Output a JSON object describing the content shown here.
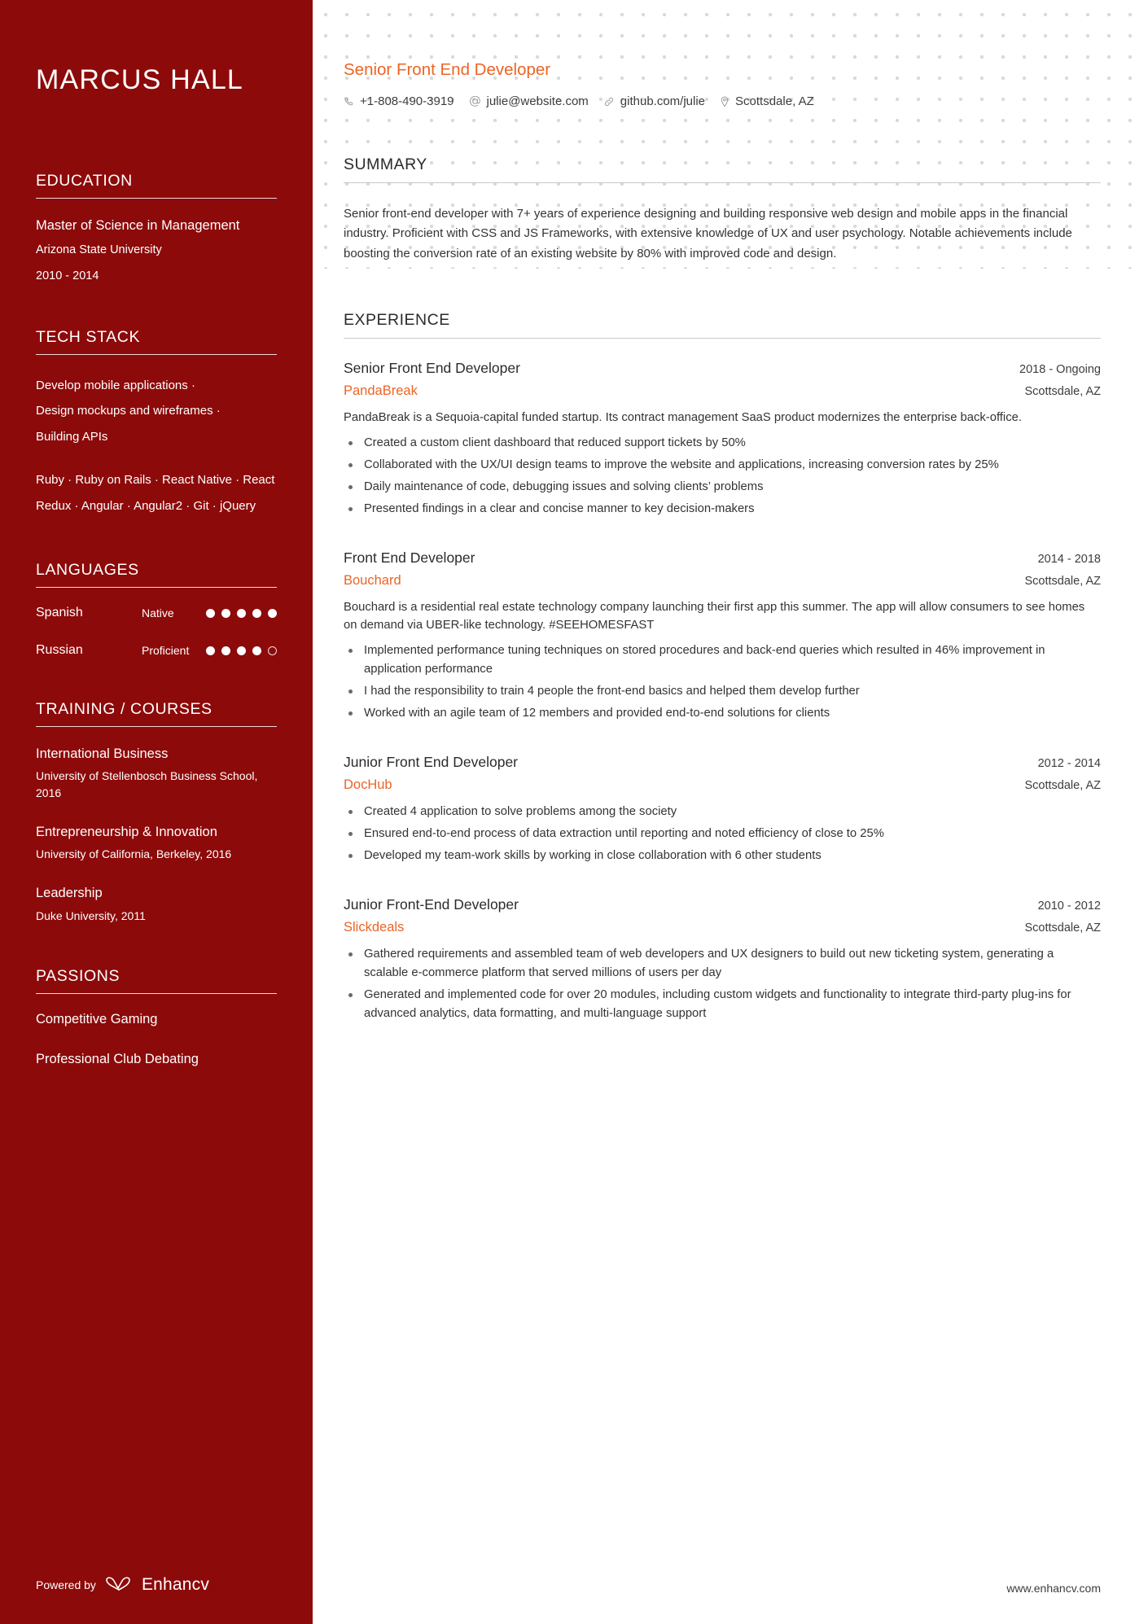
{
  "colors": {
    "sidebar_bg": "#8d0a0a",
    "accent_orange": "#ec6425",
    "text_dark": "#333333",
    "rule": "#c9c9c9"
  },
  "sidebar": {
    "name": "MARCUS HALL",
    "education": {
      "heading": "EDUCATION",
      "entries": [
        {
          "degree": "Master of Science in Management",
          "school": "Arizona State University",
          "dates": "2010 - 2014"
        }
      ]
    },
    "tech_stack": {
      "heading": "TECH STACK",
      "group_one": [
        "Develop mobile applications ·",
        "Design mockups and wireframes ·",
        "Building APIs"
      ],
      "group_two": "Ruby · Ruby on Rails · React Native · React Redux · Angular · Angular2 · Git · jQuery"
    },
    "languages": {
      "heading": "LANGUAGES",
      "items": [
        {
          "name": "Spanish",
          "level": "Native",
          "filled": 5,
          "total": 5
        },
        {
          "name": "Russian",
          "level": "Proficient",
          "filled": 4,
          "total": 5
        }
      ]
    },
    "training": {
      "heading": "TRAINING / COURSES",
      "items": [
        {
          "title": "International Business",
          "sub": "University of Stellenbosch Business School, 2016"
        },
        {
          "title": "Entrepreneurship & Innovation",
          "sub": "University of California, Berkeley, 2016"
        },
        {
          "title": "Leadership",
          "sub": "Duke University, 2011"
        }
      ]
    },
    "passions": {
      "heading": "PASSIONS",
      "items": [
        "Competitive Gaming",
        "Professional Club Debating"
      ]
    },
    "footer": {
      "powered_by": "Powered by",
      "brand": "Enhancv",
      "logo_icon": "enhancv-mark-icon"
    }
  },
  "main": {
    "job_headline": "Senior Front End Developer",
    "contact": [
      {
        "icon": "phone-icon",
        "value": "+1-808-490-3919"
      },
      {
        "icon": "at-sign-icon",
        "value": "julie@website.com"
      },
      {
        "icon": "link-icon",
        "value": "github.com/julie"
      },
      {
        "icon": "map-pin-icon",
        "value": "Scottsdale, AZ"
      }
    ],
    "summary": {
      "heading": "SUMMARY",
      "text": "Senior front-end developer with 7+ years of experience designing and building responsive web design and mobile apps in the financial industry. Proficient with CSS and JS Frameworks, with extensive knowledge of UX and user psychology. Notable achievements include boosting the conversion rate of an existing website by 80% with improved code and design."
    },
    "experience": {
      "heading": "EXPERIENCE",
      "items": [
        {
          "title": "Senior Front End Developer",
          "dates": "2018 - Ongoing",
          "company": "PandaBreak",
          "location": "Scottsdale, AZ",
          "description": "PandaBreak is a Sequoia-capital funded startup. Its contract management SaaS product modernizes the enterprise back-office.",
          "bullets": [
            "Created a custom client dashboard that reduced support tickets by 50%",
            "Collaborated with the UX/UI design teams to improve the website and applications, increasing conversion rates by 25%",
            "Daily maintenance of code, debugging issues and solving clients’ problems",
            "Presented findings in a clear and concise manner to key decision-makers"
          ]
        },
        {
          "title": "Front End Developer",
          "dates": "2014 - 2018",
          "company": "Bouchard",
          "location": "Scottsdale, AZ",
          "description": "Bouchard is a residential real estate technology company launching their first app this summer. The app will allow consumers to see homes on demand via UBER-like technology. #SEEHOMESFAST",
          "bullets": [
            "Implemented performance tuning techniques on stored procedures and back-end queries which resulted in 46% improvement in application performance",
            "I had the responsibility to train 4 people the front-end basics and helped them develop further",
            "Worked with an agile team of 12 members and provided end-to-end solutions for clients"
          ]
        },
        {
          "title": "Junior Front End Developer",
          "dates": "2012 - 2014",
          "company": "DocHub",
          "location": "Scottsdale, AZ",
          "description": "",
          "bullets": [
            "Created 4 application to solve problems among the society",
            "Ensured end-to-end process of data extraction until reporting and noted efficiency of close to 25%",
            "Developed my team-work skills by working in close collaboration with 6 other students"
          ]
        },
        {
          "title": "Junior Front-End Developer",
          "dates": "2010 - 2012",
          "company": "Slickdeals",
          "location": "Scottsdale, AZ",
          "description": "",
          "bullets": [
            "Gathered requirements and assembled team of web developers and UX designers to build out new ticketing system, generating a scalable e-commerce platform that served millions of users per day",
            "Generated and implemented code for over 20 modules, including custom widgets and functionality to integrate third-party plug-ins for advanced analytics, data formatting, and multi-language support"
          ]
        }
      ]
    },
    "footer_url": "www.enhancv.com"
  }
}
